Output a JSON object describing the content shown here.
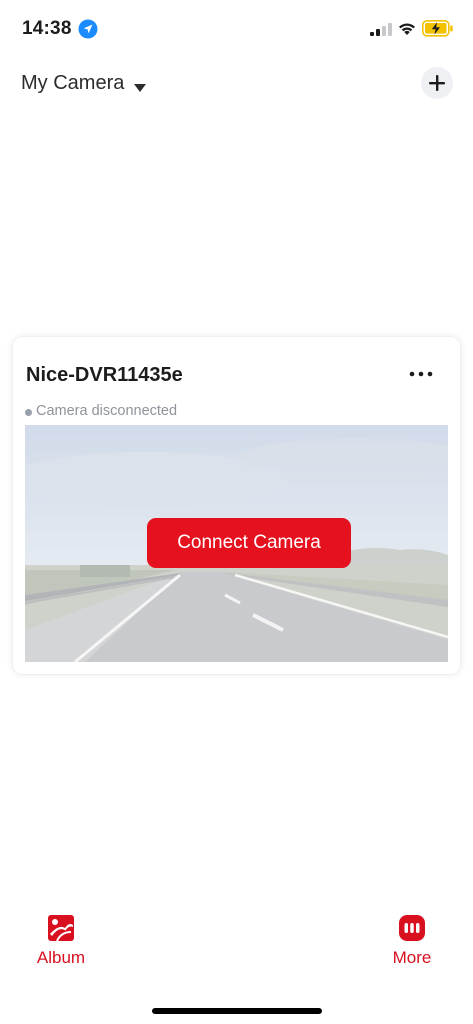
{
  "status_bar": {
    "time": "14:38"
  },
  "header": {
    "title": "My Camera"
  },
  "camera_card": {
    "device_name": "Nice-DVR11435e",
    "status_text": "Camera disconnected",
    "connect_label": "Connect Camera"
  },
  "tab_bar": {
    "items": [
      {
        "label": "Album",
        "icon": "album-icon"
      },
      {
        "label": "More",
        "icon": "more-icon"
      }
    ]
  },
  "colors": {
    "accent": "#e6111f",
    "status_dot": "#9aa0aa"
  }
}
